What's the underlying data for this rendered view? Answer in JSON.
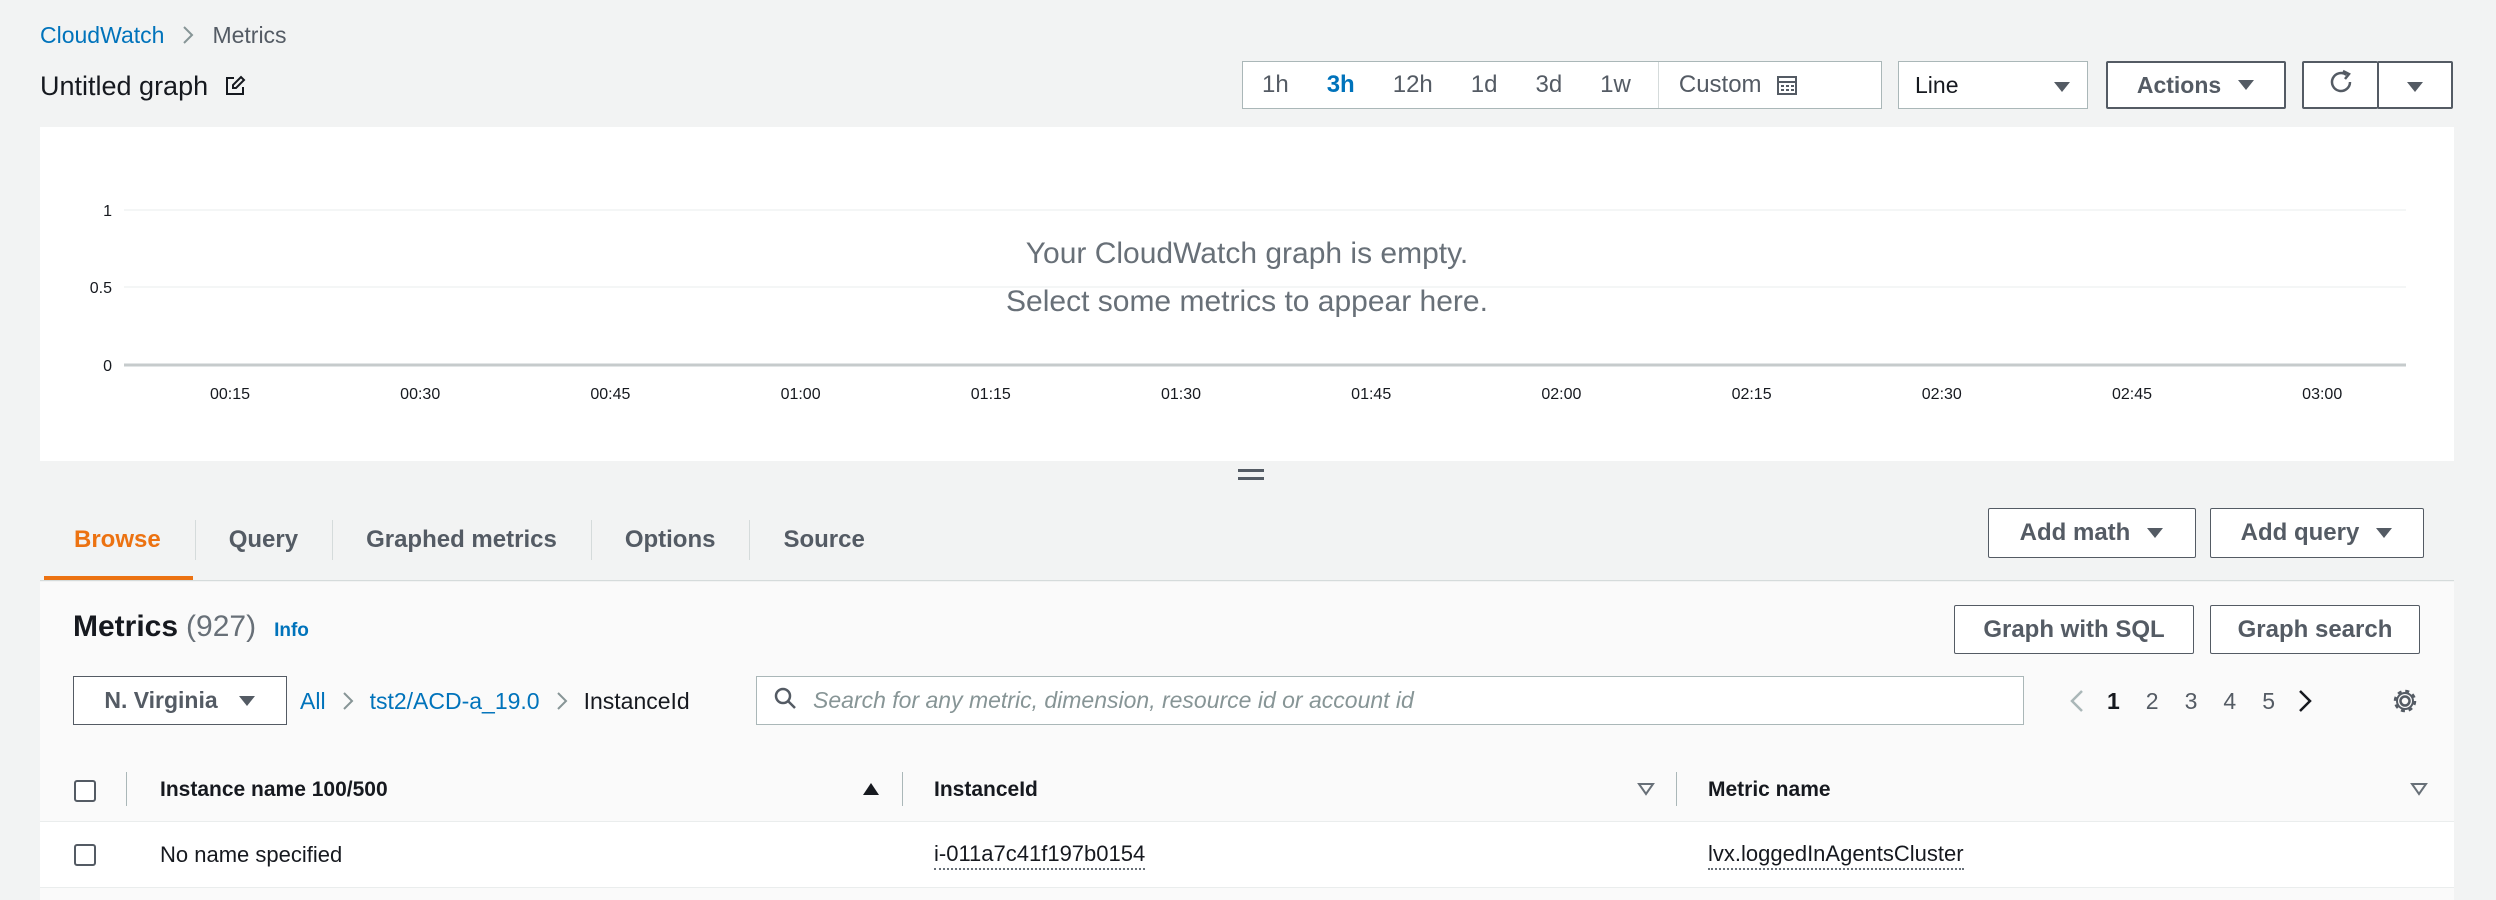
{
  "breadcrumb": {
    "root": "CloudWatch",
    "current": "Metrics"
  },
  "page_title": "Untitled graph",
  "time_range": {
    "options": [
      "1h",
      "3h",
      "12h",
      "1d",
      "3d",
      "1w"
    ],
    "selected": "3h",
    "custom_label": "Custom"
  },
  "graph_type": {
    "selected": "Line"
  },
  "actions_label": "Actions",
  "graph": {
    "empty_line1": "Your CloudWatch graph is empty.",
    "empty_line2": "Select some metrics to appear here.",
    "y_ticks": [
      "1",
      "0.5",
      "0"
    ],
    "x_ticks": [
      "00:15",
      "00:30",
      "00:45",
      "01:00",
      "01:15",
      "01:30",
      "01:45",
      "02:00",
      "02:15",
      "02:30",
      "02:45",
      "03:00"
    ]
  },
  "tabs": [
    "Browse",
    "Query",
    "Graphed metrics",
    "Options",
    "Source"
  ],
  "active_tab": "Browse",
  "add_math_label": "Add math",
  "add_query_label": "Add query",
  "metrics": {
    "title": "Metrics",
    "count": "(927)",
    "info": "Info",
    "graph_sql_label": "Graph with SQL",
    "graph_search_label": "Graph search",
    "region": "N. Virginia",
    "path": {
      "all": "All",
      "namespace": "tst2/ACD-a_19.0",
      "dimension": "InstanceId"
    },
    "search_placeholder": "Search for any metric, dimension, resource id or account id",
    "pages": [
      "1",
      "2",
      "3",
      "4",
      "5"
    ],
    "current_page": "1"
  },
  "table": {
    "columns": [
      "Instance name 100/500",
      "InstanceId",
      "Metric name"
    ],
    "rows": [
      {
        "instance_name": "No name specified",
        "instance_id": "i-011a7c41f197b0154",
        "metric_name": "lvx.loggedInAgentsCluster"
      }
    ]
  },
  "colors": {
    "accent_orange": "#ec7211",
    "link_blue": "#0073bb",
    "text_dark": "#16191f",
    "text_muted": "#545b64"
  }
}
